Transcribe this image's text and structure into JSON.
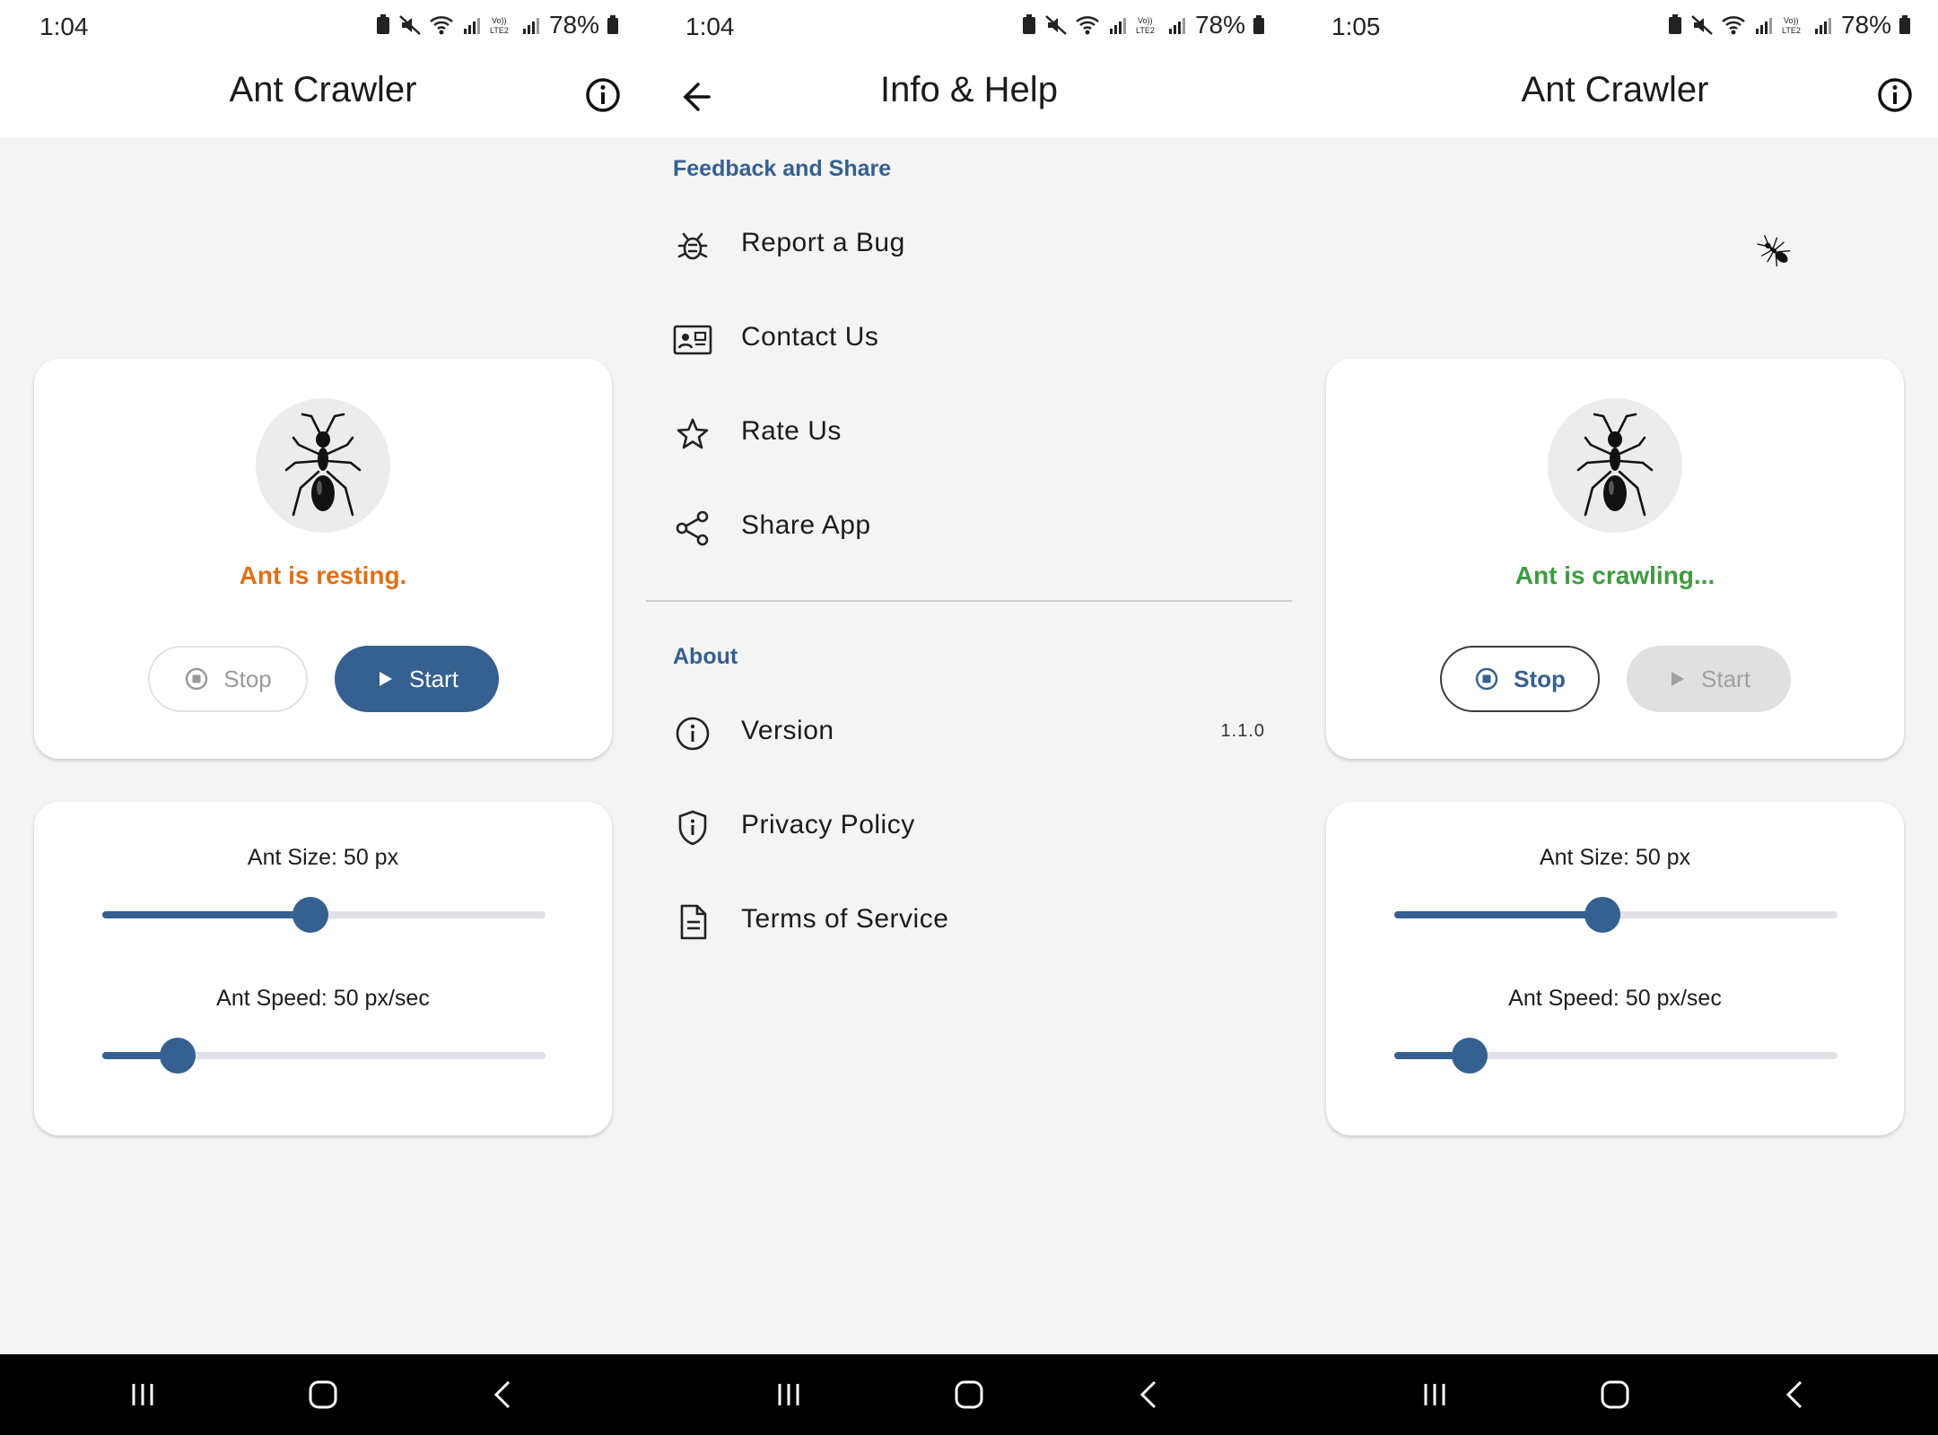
{
  "status_bar": {
    "time_1": "1:04",
    "time_2": "1:04",
    "time_3": "1:05",
    "battery": "78%"
  },
  "main": {
    "title": "Ant Crawler",
    "info_icon": "info-icon",
    "status_resting": "Ant is resting.",
    "status_crawling": "Ant is crawling...",
    "status_resting_color": "#e07018",
    "status_crawling_color": "#3f9a3f",
    "stop_label": "Stop",
    "start_label": "Start",
    "ant_size_label": "Ant Size: 50 px",
    "ant_speed_label": "Ant Speed: 50 px/sec",
    "ant_size_fraction": 0.47,
    "ant_speed_fraction": 0.17,
    "accent_color": "#35608f"
  },
  "help": {
    "title": "Info & Help",
    "back_icon": "arrow-back-icon",
    "section_feedback": "Feedback and Share",
    "section_about": "About",
    "feedback_items": [
      {
        "label": "Report a Bug",
        "icon": "bug-icon"
      },
      {
        "label": "Contact Us",
        "icon": "contact-card-icon"
      },
      {
        "label": "Rate Us",
        "icon": "star-icon"
      },
      {
        "label": "Share App",
        "icon": "share-icon"
      }
    ],
    "about_items": [
      {
        "label": "Version",
        "icon": "info-icon",
        "trailing": "1.1.0"
      },
      {
        "label": "Privacy Policy",
        "icon": "shield-icon"
      },
      {
        "label": "Terms of Service",
        "icon": "document-icon"
      }
    ]
  },
  "navigation_bar": {
    "recents_icon": "recents-icon",
    "home_icon": "home-icon",
    "back_icon": "back-chevron-icon"
  }
}
